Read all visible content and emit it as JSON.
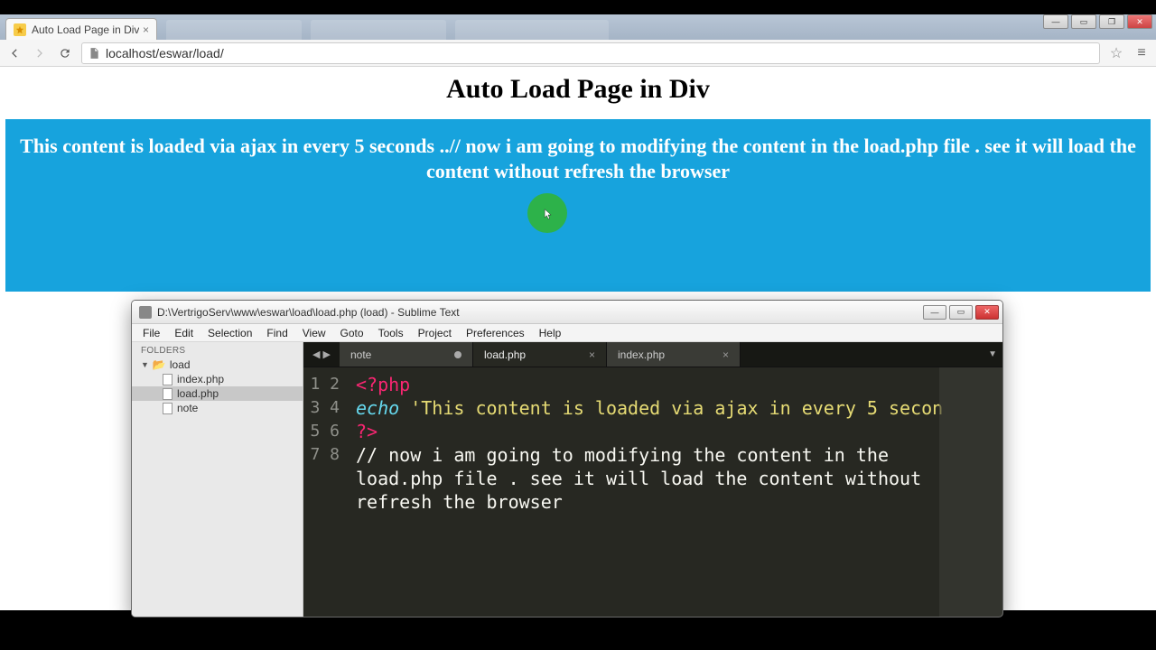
{
  "browser": {
    "tab_title": "Auto Load Page in Div us",
    "url": "localhost/eswar/load/",
    "ghost_tabs": [
      "",
      ""
    ]
  },
  "page": {
    "heading": "Auto Load Page in Div",
    "ajax_text": "This content is loaded via ajax in every 5 seconds ..// now i am going to modifying the content in the load.php file . see it will load the content without refresh the browser"
  },
  "sublime": {
    "title": "D:\\VertrigoServ\\www\\eswar\\load\\load.php (load) - Sublime Text",
    "menu": [
      "File",
      "Edit",
      "Selection",
      "Find",
      "View",
      "Goto",
      "Tools",
      "Project",
      "Preferences",
      "Help"
    ],
    "sidebar": {
      "header": "FOLDERS",
      "folder": "load",
      "files": [
        "index.php",
        "load.php",
        "note"
      ],
      "selected": "load.php"
    },
    "tabs": [
      {
        "label": "note",
        "dirty": true,
        "active": false
      },
      {
        "label": "load.php",
        "dirty": false,
        "active": true
      },
      {
        "label": "index.php",
        "dirty": false,
        "active": false
      }
    ],
    "code": {
      "line_count": 8,
      "lines": {
        "l1": "<?php",
        "l2_kw": "echo",
        "l2_str": " 'This content is loaded via ajax in every 5 secon",
        "l3": "?>",
        "l4": "// now i am going to modifying the content in the ",
        "l5": "load.php file . see it will load the content without ",
        "l6": "refresh the browser",
        "l7": "",
        "l8": ""
      }
    }
  }
}
